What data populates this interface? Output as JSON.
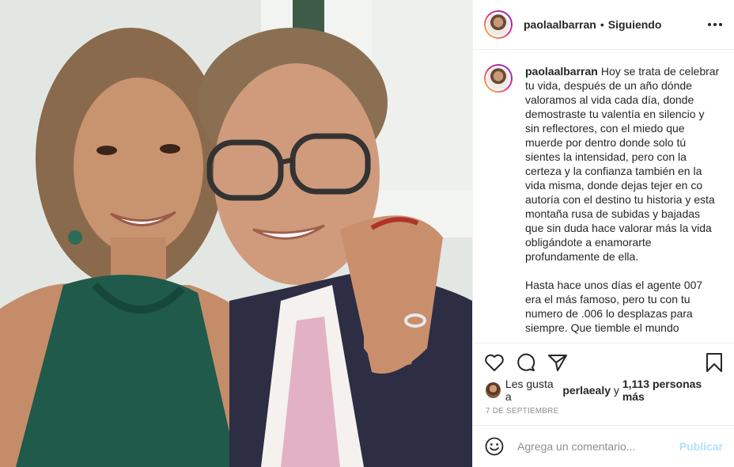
{
  "post": {
    "username": "paolaalbarran",
    "separator": "•",
    "follow_status": "Siguiendo",
    "caption_paragraphs": [
      "Hoy se trata de celebrar tu vida, después de un año dónde valoramos al vida cada día, donde demostraste tu valentía en silencio y sin reflectores, con el miedo que muerde por dentro donde solo tú sientes la intensidad, pero con la certeza y la confianza también en la vida misma, donde dejas tejer en co autoría con el destino tu historia y esta montaña rusa de subidas y bajadas que sin duda hace valorar más la vida obligándote a enamorarte profundamente de ella.",
      "Hasta hace unos días el agente 007 era el más famoso, pero tu con tu numero de .006 lo desplazas para siempre. Que tiemble el mundo"
    ],
    "likes": {
      "prefix": "Les gusta a",
      "user": "perlaealy",
      "connector": "y",
      "count_text": "1,113 personas más"
    },
    "date": "7 de septiembre",
    "comment": {
      "placeholder": "Agrega un comentario...",
      "publish_label": "Publicar"
    }
  },
  "icons": {
    "more": "more-dots-icon",
    "like": "heart-icon",
    "comment": "comment-bubble-icon",
    "share": "paper-plane-icon",
    "save": "bookmark-icon",
    "emoji": "smiley-icon"
  },
  "colors": {
    "text": "#262626",
    "muted": "#8e8e8e",
    "publish_disabled": "#b2dffc",
    "border": "#efefef"
  }
}
